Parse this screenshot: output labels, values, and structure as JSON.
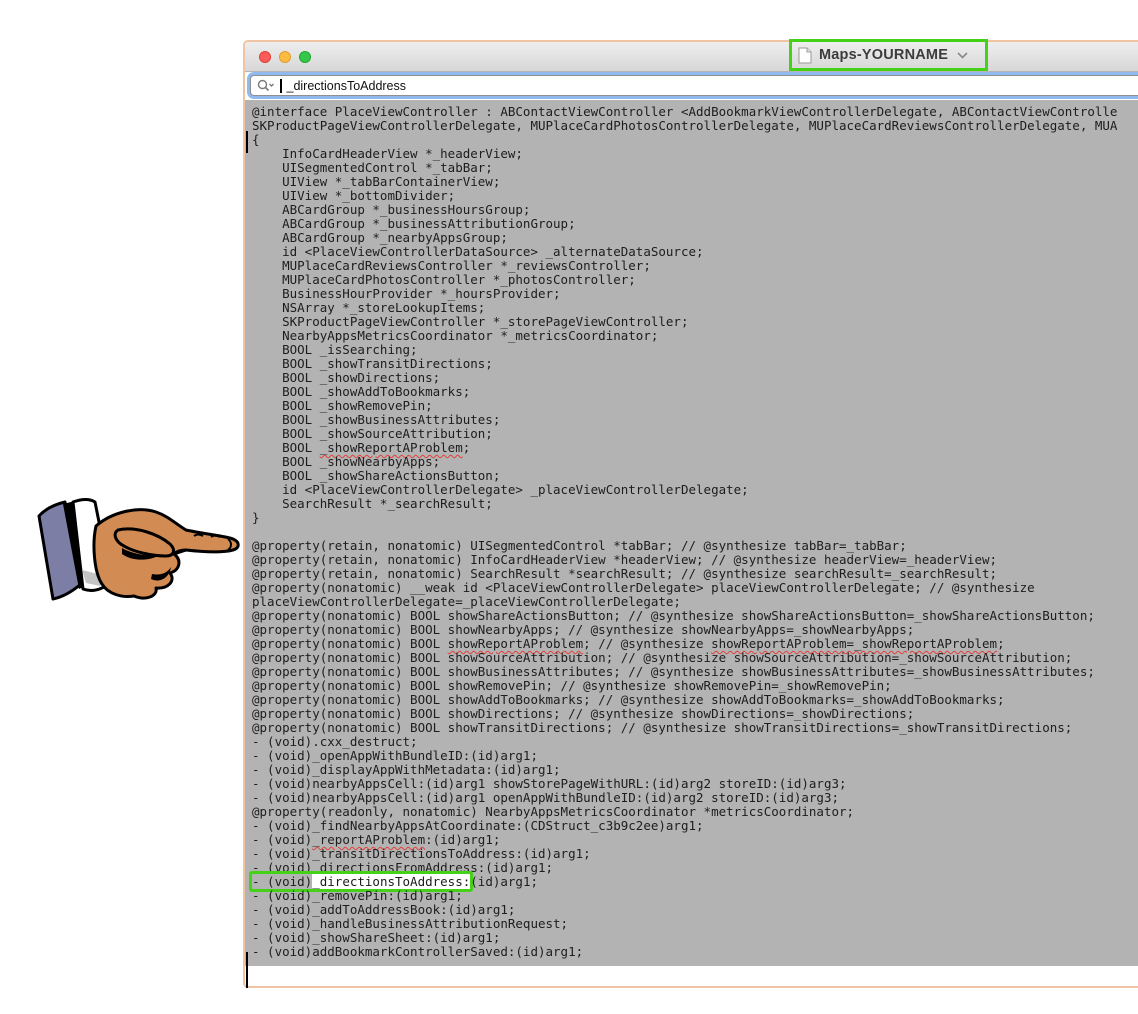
{
  "window": {
    "title": "Maps-YOURNAME",
    "traffic_lights": [
      {
        "name": "close",
        "color": "#fc5b57"
      },
      {
        "name": "minimize",
        "color": "#fcbc40"
      },
      {
        "name": "zoom",
        "color": "#34c749"
      }
    ],
    "search": {
      "value": "_directionsToAddress",
      "icon": "search-icon-with-chevron"
    }
  },
  "illustration": {
    "name": "pointing-hand",
    "description": "cartoon hand with purple sleeve pointing right at the window"
  },
  "colors": {
    "annotation_green": "#44d117",
    "window_border_peach": "#f0c3a2",
    "editor_background": "#b3b3b3",
    "find_highlight": "#ffffff",
    "misspell_red": "#e2403a",
    "skin": "#d28b52",
    "sleeve": "#7c7ea6"
  },
  "code": {
    "lines": [
      "@interface PlaceViewController : ABContactViewController <AddBookmarkViewControllerDelegate, ABContactViewControlle",
      "SKProductPageViewControllerDelegate, MUPlaceCardPhotosControllerDelegate, MUPlaceCardReviewsControllerDelegate, MUA",
      "{",
      "    InfoCardHeaderView *_headerView;",
      "    UISegmentedControl *_tabBar;",
      "    UIView *_tabBarContainerView;",
      "    UIView *_bottomDivider;",
      "    ABCardGroup *_businessHoursGroup;",
      "    ABCardGroup *_businessAttributionGroup;",
      "    ABCardGroup *_nearbyAppsGroup;",
      "    id <PlaceViewControllerDataSource> _alternateDataSource;",
      "    MUPlaceCardReviewsController *_reviewsController;",
      "    MUPlaceCardPhotosController *_photosController;",
      "    BusinessHourProvider *_hoursProvider;",
      "    NSArray *_storeLookupItems;",
      "    SKProductPageViewController *_storePageViewController;",
      "    NearbyAppsMetricsCoordinator *_metricsCoordinator;",
      "    BOOL _isSearching;",
      "    BOOL _showTransitDirections;",
      "    BOOL _showDirections;",
      "    BOOL _showAddToBookmarks;",
      "    BOOL _showRemovePin;",
      "    BOOL _showBusinessAttributes;",
      "    BOOL _showSourceAttribution;",
      "    BOOL _showReportAProblem;",
      "    BOOL _showNearbyApps;",
      "    BOOL _showShareActionsButton;",
      "    id <PlaceViewControllerDelegate> _placeViewControllerDelegate;",
      "    SearchResult *_searchResult;",
      "}",
      "",
      "@property(retain, nonatomic) UISegmentedControl *tabBar; // @synthesize tabBar=_tabBar;",
      "@property(retain, nonatomic) InfoCardHeaderView *headerView; // @synthesize headerView=_headerView;",
      "@property(retain, nonatomic) SearchResult *searchResult; // @synthesize searchResult=_searchResult;",
      "@property(nonatomic) __weak id <PlaceViewControllerDelegate> placeViewControllerDelegate; // @synthesize",
      "placeViewControllerDelegate=_placeViewControllerDelegate;",
      "@property(nonatomic) BOOL showShareActionsButton; // @synthesize showShareActionsButton=_showShareActionsButton;",
      "@property(nonatomic) BOOL showNearbyApps; // @synthesize showNearbyApps=_showNearbyApps;",
      "@property(nonatomic) BOOL showReportAProblem; // @synthesize showReportAProblem=_showReportAProblem;",
      "@property(nonatomic) BOOL showSourceAttribution; // @synthesize showSourceAttribution=_showSourceAttribution;",
      "@property(nonatomic) BOOL showBusinessAttributes; // @synthesize showBusinessAttributes=_showBusinessAttributes;",
      "@property(nonatomic) BOOL showRemovePin; // @synthesize showRemovePin=_showRemovePin;",
      "@property(nonatomic) BOOL showAddToBookmarks; // @synthesize showAddToBookmarks=_showAddToBookmarks;",
      "@property(nonatomic) BOOL showDirections; // @synthesize showDirections=_showDirections;",
      "@property(nonatomic) BOOL showTransitDirections; // @synthesize showTransitDirections=_showTransitDirections;",
      "- (void).cxx_destruct;",
      "- (void)_openAppWithBundleID:(id)arg1;",
      "- (void)_displayAppWithMetadata:(id)arg1;",
      "- (void)nearbyAppsCell:(id)arg1 showStorePageWithURL:(id)arg2 storeID:(id)arg3;",
      "- (void)nearbyAppsCell:(id)arg1 openAppWithBundleID:(id)arg2 storeID:(id)arg3;",
      "@property(readonly, nonatomic) NearbyAppsMetricsCoordinator *metricsCoordinator;",
      "- (void)_findNearbyAppsAtCoordinate:(CDStruct_c3b9c2ee)arg1;",
      "- (void)_reportAProblem:(id)arg1;",
      "- (void)_transitDirectionsToAddress:(id)arg1;",
      "- (void)_directionsFromAddress:(id)arg1;",
      "- (void)_directionsToAddress:(id)arg1;",
      "- (void)_removePin:(id)arg1;",
      "- (void)_addToAddressBook:(id)arg1;",
      "- (void)_handleBusinessAttributionRequest;",
      "- (void)_showShareSheet:(id)arg1;",
      "- (void)addBookmarkControllerSaved:(id)arg1;"
    ],
    "decorations": [
      {
        "line": 24,
        "text": "_showReportAProblem",
        "cls": "misspell"
      },
      {
        "line": 38,
        "text": "showReportAProblem=_showReportAProblem",
        "cls": "misspell"
      },
      {
        "line": 38,
        "text": "showReportAProblem",
        "cls": "misspell"
      },
      {
        "line": 52,
        "text": "_reportAProblem",
        "cls": "misspell"
      },
      {
        "line": 55,
        "text": "- (void)_directionsToAddress:",
        "cls": "green-box"
      },
      {
        "line": 55,
        "text": "_directionsToAddress:",
        "cls": "find-hit"
      }
    ]
  }
}
